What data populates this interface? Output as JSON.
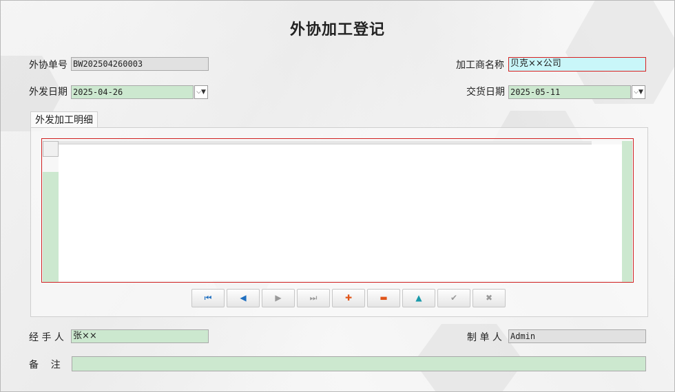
{
  "form": {
    "title": "外协加工登记",
    "order_no": {
      "label": "外协单号",
      "value": "BW202504260003"
    },
    "processor": {
      "label": "加工商名称",
      "value": "贝克××公司"
    },
    "send_date": {
      "label": "外发日期",
      "value": "2025-04-26"
    },
    "delivery_date": {
      "label": "交货日期",
      "value": "2025-05-11"
    },
    "handler": {
      "label": "经 手 人",
      "value": "张××"
    },
    "creator": {
      "label": "制 单 人",
      "value": "Admin"
    },
    "memo": {
      "label": "备    注",
      "value": ""
    }
  },
  "detail": {
    "tab_label": "外发加工明细"
  },
  "navigator": {
    "first": "⏮",
    "prior": "◀",
    "next": "▶",
    "last": "⏭",
    "insert": "✚",
    "delete": "▬",
    "edit": "▲",
    "post": "✔",
    "cancel": "✖"
  },
  "colors": {
    "readonly": "#e1e1e1",
    "editable": "#cce8cf",
    "focused": "#c9f6f9",
    "error_border": "#d82020"
  }
}
